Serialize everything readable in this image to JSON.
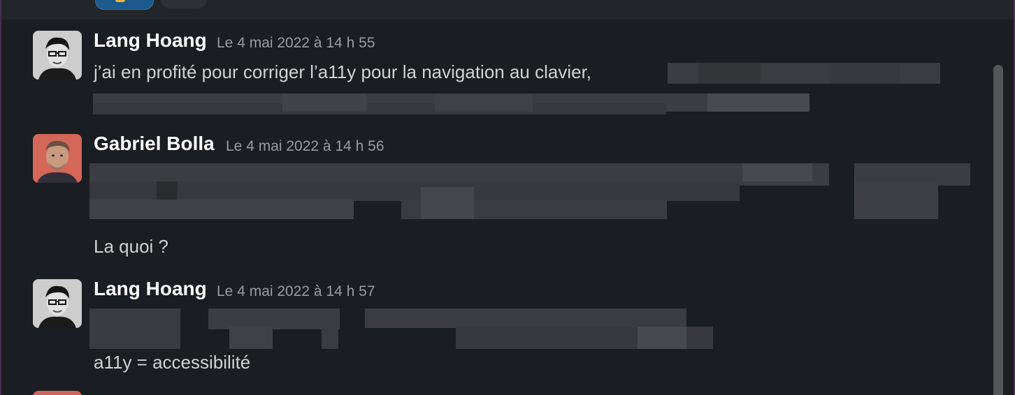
{
  "colors": {
    "background": "#1a1d21",
    "sender": "#ffffff",
    "text": "#d1d2d3",
    "timestamp": "#9a9c9f",
    "window_border": "#4a2f55"
  },
  "reactions": [
    {
      "icon": "emoji-reaction-icon"
    },
    {
      "icon": "add-reaction-icon"
    }
  ],
  "messages": [
    {
      "sender": "Lang Hoang",
      "timestamp": "Le 4 mai 2022 à 14 h 55",
      "avatar": "lang-hoang-avatar",
      "text": "j’ai en profité pour corriger l’a11y pour la navigation au clavier,"
    },
    {
      "sender": "Gabriel Bolla",
      "timestamp": "Le 4 mai 2022 à 14 h 56",
      "avatar": "gabriel-bolla-avatar",
      "text": "La quoi ?"
    },
    {
      "sender": "Lang Hoang",
      "timestamp": "Le 4 mai 2022 à 14 h 57",
      "avatar": "lang-hoang-avatar",
      "text": "a11y = accessibilité"
    }
  ]
}
